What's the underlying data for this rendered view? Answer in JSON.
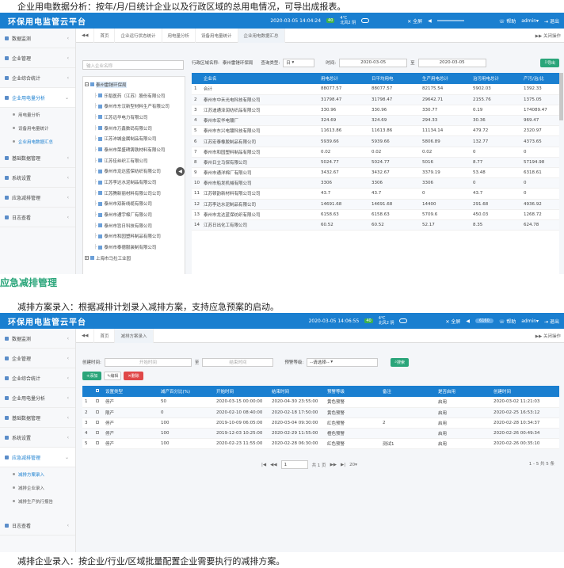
{
  "captions": {
    "c1": "企业用电数据分析：按年/月/日统计企业以及行政区域的总用电情况，可导出成报表。",
    "h2": "应急减排管理",
    "c2": "减排方案录入：根据减排计划录入减排方案，支持应急预案的启动。",
    "c3": "减排企业录入：按企业/行业/区域批量配置企业需要执行的减排方案。"
  },
  "app": {
    "title": "环保用电监管云平台"
  },
  "s1": {
    "topbar": {
      "time": "2020-03-05 14:04:24",
      "aqi": "40",
      "temp": "4℃",
      "weather": "北风2 阴",
      "fullscreen": "全屏",
      "help": "帮助",
      "user": "admin",
      "logout": "退出"
    },
    "sidebar": [
      {
        "label": "数据监测",
        "state": "closed"
      },
      {
        "label": "企业管理",
        "state": "closed"
      },
      {
        "label": "企业综合统计",
        "state": "closed"
      },
      {
        "label": "企业用电量分析",
        "state": "open",
        "children": [
          {
            "label": "用电量分析"
          },
          {
            "label": "设备用电量统计"
          },
          {
            "label": "企业用电数据汇总"
          }
        ]
      },
      {
        "label": "基础数据管理",
        "state": "closed"
      },
      {
        "label": "系统设置",
        "state": "closed"
      },
      {
        "label": "应急减排管理",
        "state": "closed"
      },
      {
        "label": "日志查看",
        "state": "closed"
      }
    ],
    "tabs": [
      "首页",
      "企业运行状态统计",
      "用电量分析",
      "设备用电量统计",
      "企业用电数据汇总"
    ],
    "tabs_right": "关闭操作",
    "tree_search": "输入企业名称",
    "tree": {
      "root": "泰州雷锤环保局",
      "nodes": [
        "乐稻医药（江苏）股份有限公司",
        "泰州市东汉新型材料生产有限公司",
        "江苏远华电力有限公司",
        "泰州市万鑫数码有限公司",
        "江苏沛城金属制品有限公司",
        "泰州市荣盛碑铸铁材料有限公司",
        "江苏佳丝织工有限公司",
        "泰州市龙达蓝保纺织有限公司",
        "江苏李达水泥制品有限公司",
        "江苏腾新丽材料有限公司公司",
        "泰州市双新线缆有限公司",
        "泰州市通宇棉厂有限公司",
        "泰州市旨日科技有限公司",
        "泰州市和园塑料制品有限公司",
        "泰州市泰德服装制有限公司"
      ],
      "next": "上海市马拉工业园"
    },
    "filter": {
      "region_label": "行政区域名称:",
      "region_value": "泰州雷锤环保局",
      "type_label": "查询类型:",
      "type_value": "日",
      "time_label": "时间:",
      "date_from": "2020-03-05",
      "to": "至",
      "date_to": "2020-03-05",
      "export": "导出"
    },
    "table": {
      "headers": [
        "",
        "企业名",
        "用电总计",
        "日平均用电",
        "生产用电总计",
        "治污用电总计",
        "产污/治/比"
      ],
      "rows": [
        [
          "1",
          "合计",
          "88077.57",
          "88077.57",
          "82175.54",
          "5902.03",
          "1392.33"
        ],
        [
          "2",
          "泰州市中禾光电科技有限公司",
          "31798.47",
          "31798.47",
          "29642.71",
          "2155.76",
          "1375.05"
        ],
        [
          "3",
          "江苏迪通泽润纺织品有限公司",
          "330.96",
          "330.96",
          "330.77",
          "0.19",
          "174089.47"
        ],
        [
          "4",
          "泰州市宏华电镀厂",
          "324.69",
          "324.69",
          "294.33",
          "30.36",
          "969.47"
        ],
        [
          "5",
          "泰州市东兴电镀科技有限公司",
          "11613.86",
          "11613.86",
          "11134.14",
          "479.72",
          "2320.97"
        ],
        [
          "6",
          "江苏宏泰橡胶制品有限公司",
          "5939.66",
          "5939.66",
          "5806.89",
          "132.77",
          "4373.65"
        ],
        [
          "7",
          "泰州市和园塑料制品有限公司",
          "0.02",
          "0.02",
          "0.02",
          "0",
          "0"
        ],
        [
          "8",
          "泰州日立马保有限公司",
          "5024.77",
          "5024.77",
          "5016",
          "8.77",
          "57194.98"
        ],
        [
          "9",
          "泰州市通洋棉厂有限公司",
          "3432.67",
          "3432.67",
          "3379.19",
          "53.48",
          "6318.61"
        ],
        [
          "10",
          "泰州市船发机械有限公司",
          "3306",
          "3306",
          "3306",
          "0",
          "0"
        ],
        [
          "11",
          "江苏顿韵新材料有限公司公司",
          "43.7",
          "43.7",
          "0",
          "43.7",
          "0"
        ],
        [
          "12",
          "江苏李达水泥制品有限公司",
          "14691.68",
          "14691.68",
          "14400",
          "291.68",
          "4936.92"
        ],
        [
          "13",
          "泰州市龙达蓝保纺织有限公司",
          "6158.63",
          "6158.63",
          "5709.6",
          "450.03",
          "1268.72"
        ],
        [
          "14",
          "江苏日出化工有限公司",
          "60.52",
          "60.52",
          "52.17",
          "8.35",
          "624.78"
        ]
      ]
    }
  },
  "s2": {
    "topbar": {
      "time": "2020-03-05 14:06:55",
      "aqi": "40",
      "temp": "4℃",
      "weather": "北风2 阴",
      "fullscreen": "全屏",
      "counter": "6160",
      "help": "帮助",
      "user": "admin",
      "logout": "退出"
    },
    "sidebar": [
      {
        "label": "数据监测",
        "state": "closed"
      },
      {
        "label": "企业管理",
        "state": "closed"
      },
      {
        "label": "企业综合统计",
        "state": "closed"
      },
      {
        "label": "企业用电量分析",
        "state": "closed"
      },
      {
        "label": "基础数据管理",
        "state": "closed"
      },
      {
        "label": "系统设置",
        "state": "closed"
      },
      {
        "label": "应急减排管理",
        "state": "open",
        "children": [
          {
            "label": "减排方案录入"
          },
          {
            "label": "减排企业录入"
          },
          {
            "label": "减排生产执行报告"
          }
        ]
      },
      {
        "label": "日志查看",
        "state": "closed"
      }
    ],
    "tabs": [
      "首页",
      "减排方案录入"
    ],
    "tabs_right": "关闭操作",
    "filter": {
      "created_label": "创建时间:",
      "start_ph": "开始时间",
      "to": "至",
      "end_ph": "结束时间",
      "level_label": "预警等级:",
      "level_value": "--请选择--",
      "search": "搜索"
    },
    "toolbar": {
      "add": "添加",
      "edit": "编辑",
      "del": "删除"
    },
    "table": {
      "headers": [
        "",
        "",
        "设置类型",
        "减产百分比(%)",
        "开始时间",
        "结束时间",
        "预警等级",
        "备注",
        "是否启用",
        "创建时间"
      ],
      "rows": [
        [
          "1",
          "",
          "停产",
          "50",
          "2020-03-15 00:00:00",
          "2020-04-30 23:55:00",
          "黄色预警",
          "",
          "启用",
          "2020-03-02 11:21:03"
        ],
        [
          "2",
          "",
          "限产",
          "0",
          "2020-02-10 08:40:00",
          "2020-02-18 17:50:00",
          "黄色预警",
          "",
          "启用",
          "2020-02-25 16:53:12"
        ],
        [
          "3",
          "",
          "停产",
          "100",
          "2019-10-09 06:05:00",
          "2020-03-04 09:30:00",
          "红色预警",
          "2",
          "启用",
          "2020-02-28 10:34:37"
        ],
        [
          "4",
          "",
          "停产",
          "100",
          "2019-12-03 10:25:00",
          "2020-02-29 11:55:00",
          "橙色预警",
          "",
          "启用",
          "2020-02-26 00:49:34"
        ],
        [
          "5",
          "",
          "停产",
          "100",
          "2020-02-23 11:55:00",
          "2020-02-28 06:30:00",
          "红色预警",
          "测试1",
          "启用",
          "2020-02-26 00:35:10"
        ]
      ]
    },
    "pager": {
      "page": "1",
      "of": "共 1 页",
      "per": "20",
      "summary": "1 - 5 共 5 条"
    }
  }
}
